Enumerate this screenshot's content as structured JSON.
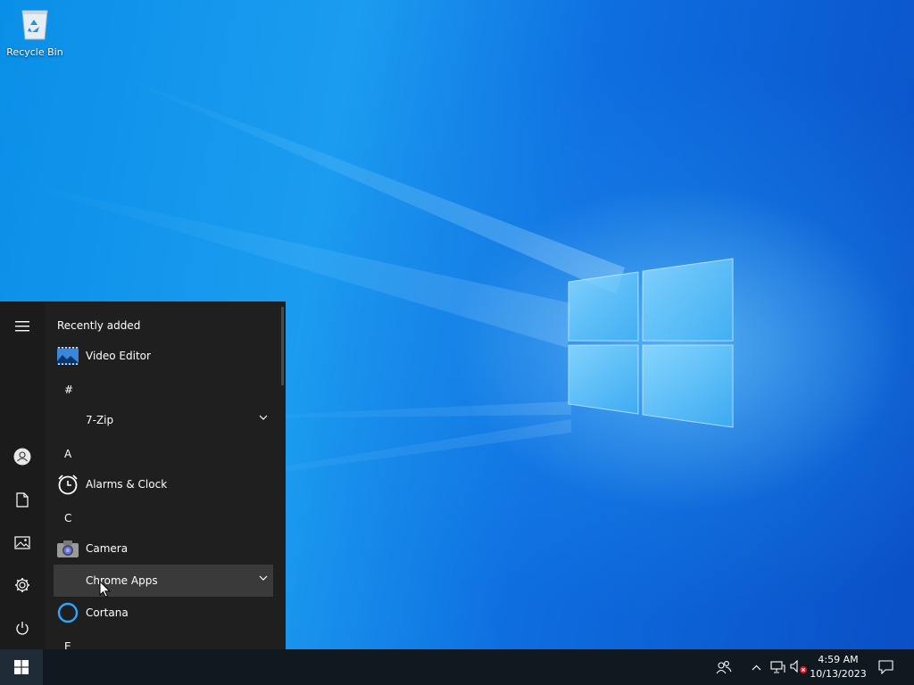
{
  "desktop": {
    "icons": [
      {
        "label": "Recycle Bin",
        "icon": "recycle-bin-icon"
      }
    ]
  },
  "start_menu": {
    "rail": {
      "items": [
        {
          "name": "expand",
          "icon": "hamburger-icon"
        },
        {
          "name": "account",
          "icon": "user-icon"
        },
        {
          "name": "documents",
          "icon": "document-icon"
        },
        {
          "name": "pictures",
          "icon": "picture-icon"
        },
        {
          "name": "settings",
          "icon": "gear-icon"
        },
        {
          "name": "power",
          "icon": "power-icon"
        }
      ]
    },
    "recently_added_label": "Recently added",
    "recent_app": {
      "label": "Video Editor",
      "icon": "video-editor-icon"
    },
    "sections": {
      "hash": "#",
      "a": "A",
      "c": "C",
      "e": "E"
    },
    "apps": {
      "seven_zip": {
        "label": "7-Zip",
        "icon": "folder-icon",
        "expandable": true
      },
      "alarms": {
        "label": "Alarms & Clock",
        "icon": "alarm-clock-icon"
      },
      "camera": {
        "label": "Camera",
        "icon": "camera-icon"
      },
      "chrome_apps": {
        "label": "Chrome Apps",
        "icon": "folder-icon",
        "expandable": true
      },
      "cortana": {
        "label": "Cortana",
        "icon": "cortana-icon"
      }
    }
  },
  "taskbar": {
    "start_icon": "windows-logo-icon",
    "tray": {
      "people_icon": "people-icon",
      "show_hidden_icon": "chevron-up-icon",
      "network_icon": "network-icon",
      "volume_icon": "volume-muted-icon",
      "notifications_icon": "action-center-icon"
    },
    "clock": {
      "time": "4:59 AM",
      "date": "10/13/2023"
    }
  },
  "colors": {
    "start_menu_bg": "#1f1f1f",
    "taskbar_bg": "#101820",
    "hover_bg": "#3a3a3a",
    "accent": "#0078d7",
    "cortana_ring": "#2fa6ff"
  }
}
